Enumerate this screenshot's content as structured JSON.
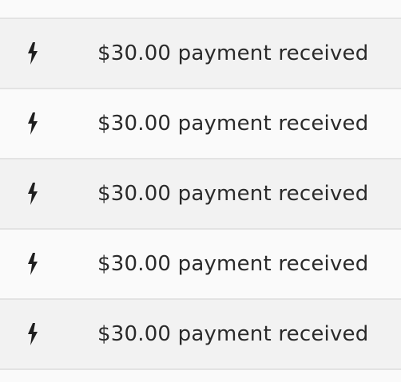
{
  "notifications": [
    {
      "icon": "lightning-bolt-icon",
      "text": "$30.00 payment received"
    },
    {
      "icon": "lightning-bolt-icon",
      "text": "$30.00 payment received"
    },
    {
      "icon": "lightning-bolt-icon",
      "text": "$30.00 payment received"
    },
    {
      "icon": "lightning-bolt-icon",
      "text": "$30.00 payment received"
    },
    {
      "icon": "lightning-bolt-icon",
      "text": "$30.00 payment received"
    }
  ],
  "colors": {
    "row_alt": "#f2f2f2",
    "row_plain": "#fafafa",
    "divider": "#e3e3e3",
    "text": "#2a2a2a",
    "icon": "#1f1f1f"
  }
}
